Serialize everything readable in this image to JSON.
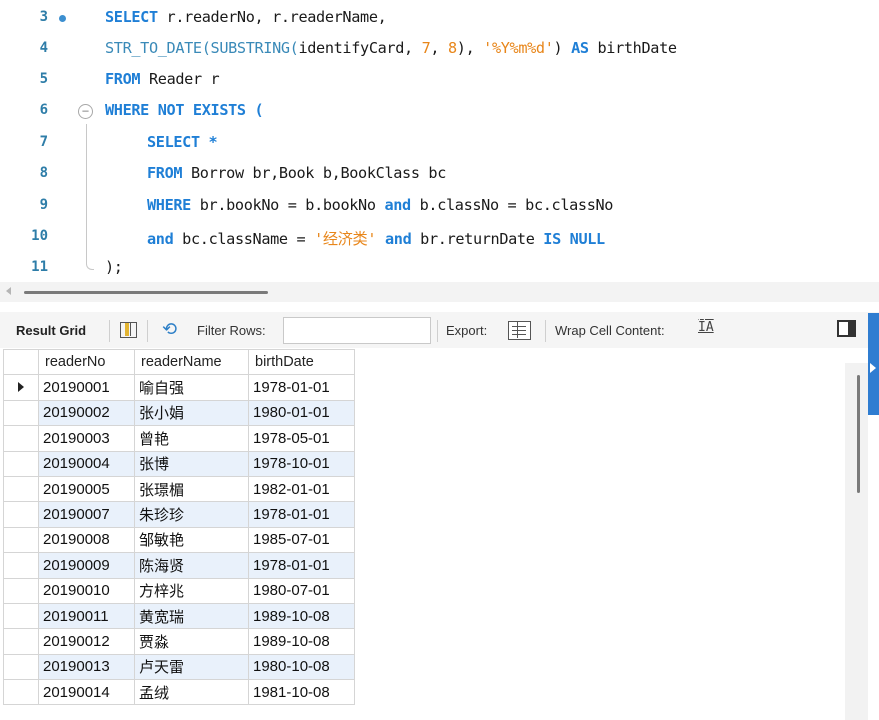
{
  "editor": {
    "lines": [
      {
        "num": "3"
      },
      {
        "num": "4"
      },
      {
        "num": "5"
      },
      {
        "num": "6"
      },
      {
        "num": "7"
      },
      {
        "num": "8"
      },
      {
        "num": "9"
      },
      {
        "num": "10"
      },
      {
        "num": "11"
      }
    ],
    "code": {
      "l3_kw1": "SELECT",
      "l3_rest": " r.readerNo, r.readerName,",
      "l4_fn": "STR_TO_DATE(SUBSTRING(",
      "l4_mid": "identifyCard, ",
      "l4_n1": "7",
      "l4_c": ", ",
      "l4_n2": "8",
      "l4_p": "), ",
      "l4_str": "'%Y%m%d'",
      "l4_p2": ") ",
      "l4_kw": "AS",
      "l4_alias": " birthDate",
      "l5_kw": "FROM",
      "l5_rest": " Reader r",
      "l6_kw": "WHERE NOT EXISTS",
      "l6_rest": " (",
      "l7_kw": "SELECT",
      "l7_rest": " *",
      "l8_kw": "FROM",
      "l8_rest": " Borrow br,Book b,BookClass bc",
      "l9_kw": "WHERE",
      "l9_a": " br.bookNo = b.bookNo ",
      "l9_and": "and",
      "l9_b": " b.classNo = bc.classNo",
      "l10_and": "and",
      "l10_a": " bc.className = ",
      "l10_str": "'经济类'",
      "l10_sp": " ",
      "l10_and2": "and",
      "l10_b": " br.returnDate ",
      "l10_kw": "IS NULL",
      "l11_text": ");"
    }
  },
  "toolbar": {
    "result_grid_label": "Result Grid",
    "filter_rows_label": "Filter Rows:",
    "filter_value": "",
    "export_label": "Export:",
    "wrap_label": "Wrap Cell Content:",
    "wrap_icon_glyph": "ĪA"
  },
  "grid": {
    "columns": [
      "readerNo",
      "readerName",
      "birthDate"
    ],
    "rows": [
      [
        "20190001",
        "喻自强",
        "1978-01-01"
      ],
      [
        "20190002",
        "张小娟",
        "1980-01-01"
      ],
      [
        "20190003",
        "曾艳",
        "1978-05-01"
      ],
      [
        "20190004",
        "张博",
        "1978-10-01"
      ],
      [
        "20190005",
        "张璟楣",
        "1982-01-01"
      ],
      [
        "20190007",
        "朱珍珍",
        "1978-01-01"
      ],
      [
        "20190008",
        "邹敏艳",
        "1985-07-01"
      ],
      [
        "20190009",
        "陈海贤",
        "1978-01-01"
      ],
      [
        "20190010",
        "方梓兆",
        "1980-07-01"
      ],
      [
        "20190011",
        "黄宽瑞",
        "1989-10-08"
      ],
      [
        "20190012",
        "贾淼",
        "1989-10-08"
      ],
      [
        "20190013",
        "卢天雷",
        "1980-10-08"
      ],
      [
        "20190014",
        "孟绒",
        "1981-10-08"
      ]
    ]
  },
  "colors": {
    "keyword": "#1f7fd6",
    "string": "#e8861a",
    "row_alt": "#e9f1fb",
    "accent": "#2f7dd1"
  }
}
